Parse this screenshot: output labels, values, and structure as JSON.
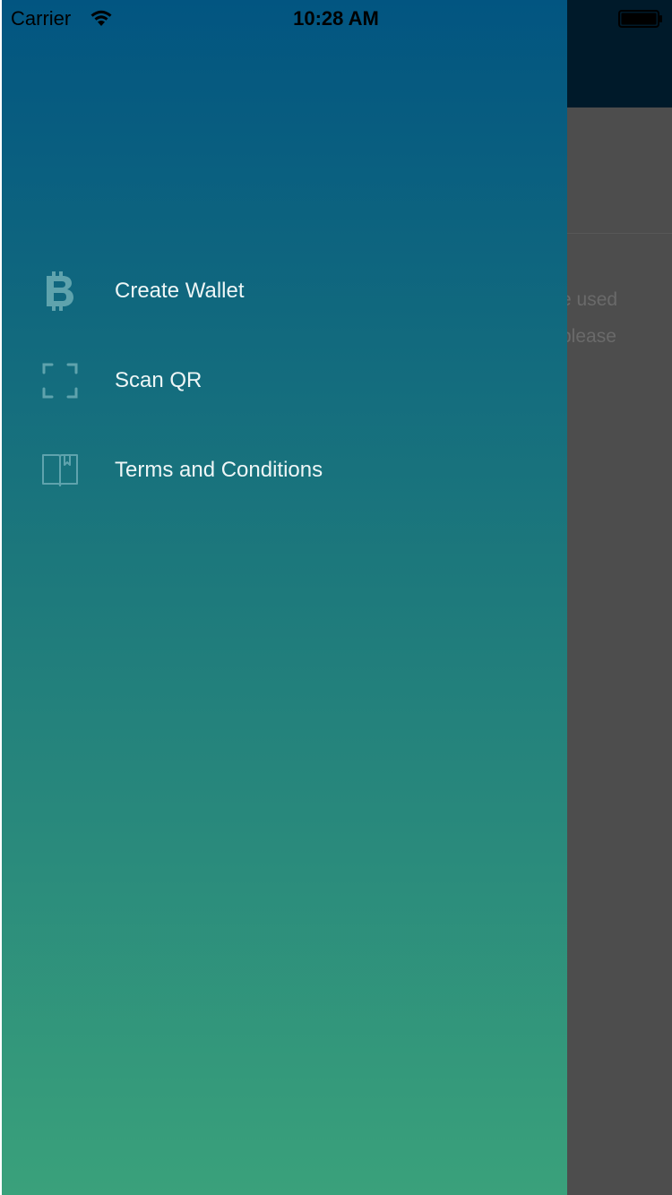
{
  "status_bar": {
    "carrier": "Carrier",
    "time": "10:28 AM"
  },
  "background_screen": {
    "text_line_1": "e used",
    "text_line_2": "please"
  },
  "drawer": {
    "menu_items": [
      {
        "label": "Create Wallet",
        "icon": "bitcoin-icon"
      },
      {
        "label": "Scan QR",
        "icon": "scan-qr-icon"
      },
      {
        "label": "Terms and Conditions",
        "icon": "book-icon"
      }
    ],
    "colors": {
      "gradient_top": "#025581",
      "gradient_bottom": "#3aa17b",
      "icon": "#5fa3ad",
      "label": "#eef6f6"
    }
  }
}
